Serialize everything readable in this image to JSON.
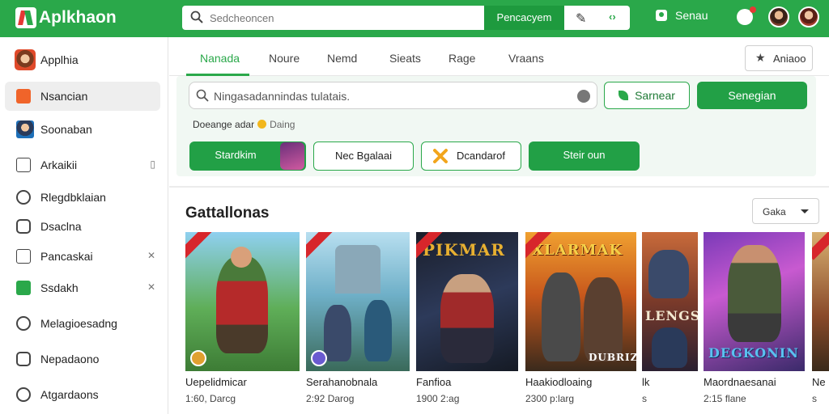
{
  "app": {
    "title": "Aplkhaon"
  },
  "header": {
    "search_placeholder": "Sedcheoncen",
    "search_button": "Pencacyem",
    "user_label": "Senau"
  },
  "sidebar": {
    "items": [
      {
        "label": "Applhia"
      },
      {
        "label": "Nsancian"
      },
      {
        "label": "Soonaban"
      },
      {
        "label": "Arkaikii"
      },
      {
        "label": "Rlegdbklaian"
      },
      {
        "label": "Dsaclna"
      },
      {
        "label": "Pancaskai"
      },
      {
        "label": "Ssdakh"
      },
      {
        "label": "Melagioesadng"
      },
      {
        "label": "Nepadaono"
      },
      {
        "label": "Atgardaons"
      }
    ]
  },
  "tabs": [
    {
      "label": "Nanada"
    },
    {
      "label": "Noure"
    },
    {
      "label": "Nemd"
    },
    {
      "label": "Sieats"
    },
    {
      "label": "Rage"
    },
    {
      "label": "Vraans"
    }
  ],
  "action_button": "Aniaoo",
  "filter": {
    "input_value": "Ningasadannindas tulatais.",
    "button_outline": "Sarnear",
    "button_solid": "Senegian",
    "hint_text": "Doeange adar",
    "hint_sub": "Daing",
    "chips": [
      "Stardkim",
      "Nec Bgalaai",
      "Dcandarof",
      "Steir oun"
    ]
  },
  "section": {
    "title": "Gattallonas",
    "sort_label": "Gaka"
  },
  "games": [
    {
      "name": "Uepelidmicar",
      "meta": "1:60, Darcg"
    },
    {
      "name": "Serahanobnala",
      "meta": "2:92 Darog"
    },
    {
      "name": "Fanfioa",
      "meta": "1900 2:ag",
      "art_title": "PIKMAR"
    },
    {
      "name": "Haakiodloaing",
      "meta": "2300 p:larg",
      "art_title": "XLARMAK",
      "art_sub": "DUBRIZE"
    },
    {
      "name": "lk",
      "meta": "s",
      "art_title": "LENGS"
    },
    {
      "name": "Maordnaesanai",
      "meta": "2:15 flane",
      "art_title": "DEGKONIN"
    },
    {
      "name": "Ne",
      "meta": "s"
    }
  ],
  "colors": {
    "brand": "#2aa84a",
    "brand_dark": "#1e9a3e",
    "accent_red": "#e53935"
  }
}
